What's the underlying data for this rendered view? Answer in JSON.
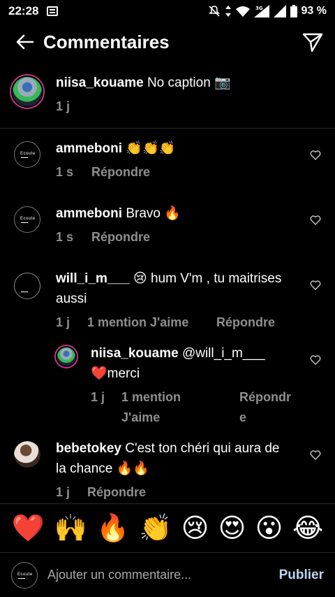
{
  "status_bar": {
    "time": "22:28",
    "battery": "93 %",
    "network": "3G"
  },
  "header": {
    "title": "Commentaires"
  },
  "caption": {
    "username": "niisa_kouame",
    "text": "No caption 📷",
    "age": "1 j"
  },
  "comments": [
    {
      "username": "ammeboni",
      "text": "👏👏👏",
      "age": "1 s",
      "reply": "Répondre"
    },
    {
      "username": "ammeboni",
      "text": "Bravo 🔥",
      "age": "1 s",
      "reply": "Répondre"
    },
    {
      "username": "will_i_m___",
      "text_line1": "😢 hum V'm , tu maitrises",
      "text_line2": "aussi",
      "age": "1 j",
      "likes": "1 mention J'aime",
      "reply": "Répondre"
    },
    {
      "username": "niisa_kouame",
      "text_line1": "@will_i_m___",
      "text_line2": "❤️merci",
      "age": "1 j",
      "likes_line1": "1 mention",
      "likes_line2": "J'aime",
      "reply_line1": "Répondr",
      "reply_line2": "e"
    },
    {
      "username": "bebetokey",
      "text_line1": "C'est ton chéri qui aura de",
      "text_line2": "la chance 🔥🔥",
      "age": "1 j",
      "reply": "Répondre"
    }
  ],
  "emoji_bar": [
    "❤️",
    "🙌",
    "🔥",
    "👏",
    "😢",
    "😍",
    "😮",
    "😂"
  ],
  "composer": {
    "placeholder": "Ajouter un commentaire...",
    "publish": "Publier"
  }
}
